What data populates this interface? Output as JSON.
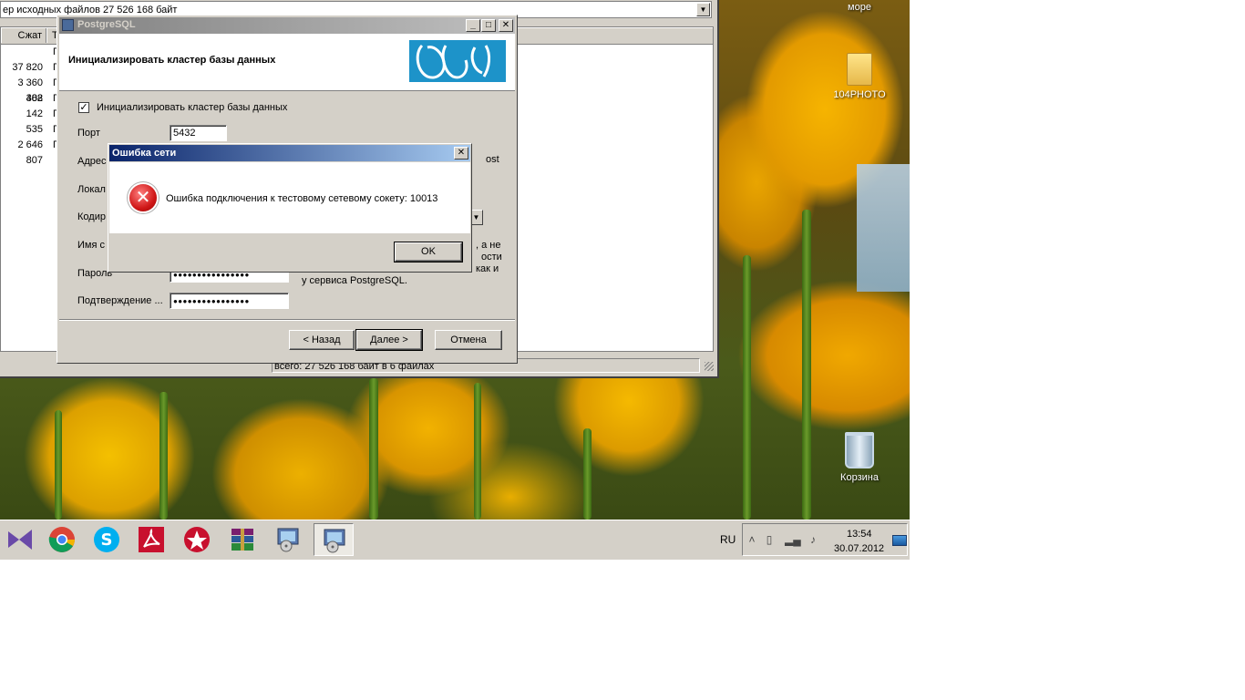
{
  "archive_window": {
    "path_text": "ер исходных файлов 27 526 168 байт",
    "col_packed": "Сжат",
    "col_type": "Т",
    "rows": [
      {
        "size": "",
        "type": "П"
      },
      {
        "size": "37 820",
        "type": "П"
      },
      {
        "size": "3 360 388",
        "type": "П"
      },
      {
        "size": "402",
        "type": "П"
      },
      {
        "size": "142",
        "type": "П"
      },
      {
        "size": "535",
        "type": "П"
      },
      {
        "size": "2 646 807",
        "type": "П"
      }
    ],
    "status_text": "всего: 27 526 168 байт в 6 файлах"
  },
  "installer": {
    "title": "PostgreSQL",
    "heading": "Инициализировать кластер базы данных",
    "init_checkbox_label": "Инициализировать кластер базы данных",
    "init_checked": true,
    "fields": {
      "port_label": "Порт",
      "port_value": "5432",
      "address_label": "Адрес",
      "address_tail": "ost",
      "locale_label": "Локал",
      "encoding_label": "Кодир",
      "name_label": "Имя с",
      "password_label": "Пароль",
      "password_value": "●●●●●●●●●●●●●●●●",
      "confirm_label": "Подтверждение ...",
      "confirm_value": "●●●●●●●●●●●●●●●●"
    },
    "note_lines": [
      ", а не",
      "ости",
      "как и",
      "у сервиса PostgreSQL."
    ],
    "buttons": {
      "back": "< Назад",
      "next": "Далее >",
      "cancel": "Отмена"
    }
  },
  "error_dialog": {
    "title": "Ошибка сети",
    "message": "Ошибка подключения к тестовому сетевому сокету: 10013",
    "ok_label": "OK",
    "close_glyph": "✕"
  },
  "desktop": {
    "icons": [
      {
        "label": "море"
      },
      {
        "label": "104PHOTO"
      },
      {
        "label": "Корзина"
      }
    ]
  },
  "taskbar": {
    "apps": [
      {
        "name": "visual-studio"
      },
      {
        "name": "chrome"
      },
      {
        "name": "skype"
      },
      {
        "name": "acrobat"
      },
      {
        "name": "pokerstars"
      },
      {
        "name": "winrar"
      },
      {
        "name": "installer"
      },
      {
        "name": "installer-active"
      }
    ],
    "language": "RU",
    "time": "13:54",
    "date": "30.07.2012"
  }
}
